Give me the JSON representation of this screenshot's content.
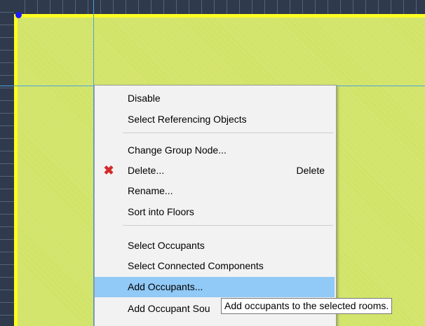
{
  "context_menu": {
    "items": [
      {
        "label": "Disable"
      },
      {
        "label": "Select Referencing Objects"
      },
      {
        "label": "Change Group Node..."
      },
      {
        "label": "Delete...",
        "shortcut": "Delete",
        "icon": "delete-x-icon"
      },
      {
        "label": "Rename..."
      },
      {
        "label": "Sort into Floors"
      },
      {
        "label": "Select Occupants"
      },
      {
        "label": "Select Connected Components"
      },
      {
        "label": "Add Occupants..."
      },
      {
        "label": "Add Occupant Sou"
      }
    ],
    "highlighted_index": 8
  },
  "tooltip": {
    "text": "Add occupants to the selected rooms."
  },
  "colors": {
    "room_fill": "#cfe25f",
    "room_border": "#ffff22",
    "highlight": "#91c9f7",
    "ruler": "#2f3a4c",
    "guide": "#4aa3df",
    "delete_icon": "#d32a2a"
  }
}
